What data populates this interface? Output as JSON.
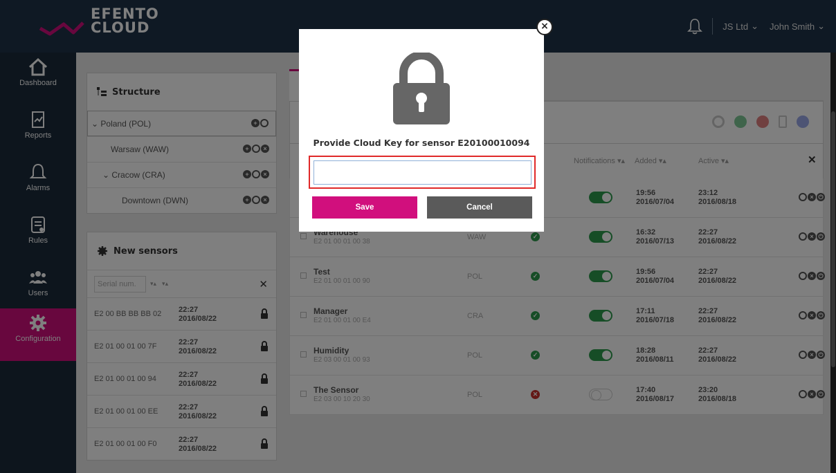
{
  "brand": {
    "line1": "EFENTO",
    "line2": "CLOUD"
  },
  "topbar": {
    "company": "JS Ltd",
    "user": "John Smith"
  },
  "nav": [
    {
      "label": "Dashboard",
      "icon": "home-icon"
    },
    {
      "label": "Reports",
      "icon": "report-icon"
    },
    {
      "label": "Alarms",
      "icon": "bell-icon"
    },
    {
      "label": "Rules",
      "icon": "rules-icon"
    },
    {
      "label": "Users",
      "icon": "users-icon"
    },
    {
      "label": "Configuration",
      "icon": "gear-icon",
      "active": true
    }
  ],
  "structure": {
    "title": "Structure",
    "items": [
      {
        "label": "Poland (POL)"
      },
      {
        "label": "Warsaw (WAW)"
      },
      {
        "label": "Cracow (CRA)"
      },
      {
        "label": "Downtown (DWN)"
      }
    ]
  },
  "new_sensors": {
    "title": "New sensors",
    "filter_placeholder": "Serial num.",
    "rows": [
      {
        "serial": "E2 00 BB BB BB 02",
        "time": "22:27",
        "date": "2016/08/22"
      },
      {
        "serial": "E2 01 00 01 00 7F",
        "time": "22:27",
        "date": "2016/08/22"
      },
      {
        "serial": "E2 01 00 01 00 94",
        "time": "22:27",
        "date": "2016/08/22"
      },
      {
        "serial": "E2 01 00 01 00 EE",
        "time": "22:27",
        "date": "2016/08/22"
      },
      {
        "serial": "E2 01 00 01 00 F0",
        "time": "22:27",
        "date": "2016/08/22"
      }
    ]
  },
  "table": {
    "headers": {
      "notifications": "Notifications",
      "added": "Added",
      "active": "Active"
    },
    "rows": [
      {
        "name": "",
        "serial": "",
        "loc": "",
        "status": "ok",
        "notif": true,
        "added_t": "19:56",
        "added_d": "2016/07/04",
        "active_t": "23:12",
        "active_d": "2016/08/18"
      },
      {
        "name": "Warehouse",
        "serial": "E2 01 00 01 00 38",
        "loc": "WAW",
        "status": "ok",
        "notif": true,
        "added_t": "16:32",
        "added_d": "2016/07/13",
        "active_t": "22:27",
        "active_d": "2016/08/22"
      },
      {
        "name": "Test",
        "serial": "E2 01 00 01 00 90",
        "loc": "POL",
        "status": "ok",
        "notif": true,
        "added_t": "19:56",
        "added_d": "2016/07/04",
        "active_t": "22:27",
        "active_d": "2016/08/22"
      },
      {
        "name": "Manager",
        "serial": "E2 01 00 01 00 E4",
        "loc": "CRA",
        "status": "ok",
        "notif": true,
        "added_t": "17:11",
        "added_d": "2016/07/18",
        "active_t": "22:27",
        "active_d": "2016/08/22"
      },
      {
        "name": "Humidity",
        "serial": "E2 03 00 01 00 93",
        "loc": "POL",
        "status": "ok",
        "notif": true,
        "added_t": "18:28",
        "added_d": "2016/08/11",
        "active_t": "22:27",
        "active_d": "2016/08/22"
      },
      {
        "name": "The Sensor",
        "serial": "E2 03 00 10 20 30",
        "loc": "POL",
        "status": "error",
        "notif": false,
        "added_t": "17:40",
        "added_d": "2016/08/17",
        "active_t": "23:20",
        "active_d": "2016/08/18"
      }
    ]
  },
  "modal": {
    "title": "Provide Cloud Key for sensor E20100010094",
    "input_value": "",
    "save_label": "Save",
    "cancel_label": "Cancel",
    "close_label": "×"
  },
  "colors": {
    "accent": "#d10f7d",
    "topbar": "#1e3349",
    "ok": "#2c9b4d",
    "error": "#c9302c"
  }
}
